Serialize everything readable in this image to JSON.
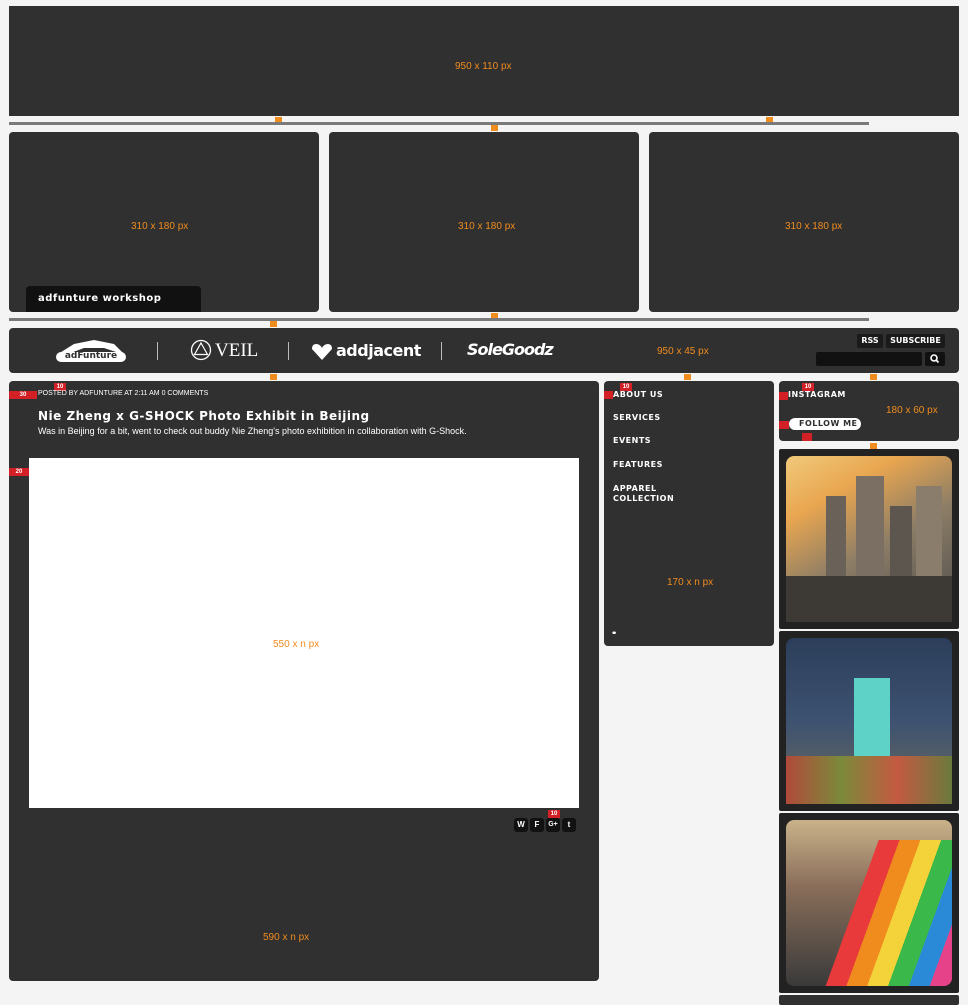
{
  "banner": {
    "dims": "950 x 110 px"
  },
  "slides": [
    {
      "dims": "310 x 180 px"
    },
    {
      "dims": "310 x 180 px"
    },
    {
      "dims": "310 x 180 px"
    }
  ],
  "slide_caption": "adfunture workshop",
  "nav": {
    "brands": [
      "adFunture",
      "VEIL",
      "addjacent",
      "SoleGoodz"
    ],
    "dims": "950 x 45 px",
    "rss_label": "RSS",
    "subscribe_label": "SUBSCRIBE",
    "search_value": ""
  },
  "post": {
    "meta": "POSTED BY ADFUNTURE AT 2:11 AM 0 comments",
    "title": "Nie Zheng x G-SHOCK Photo Exhibit in Beijing",
    "excerpt": "Was in Beijing for a bit, went to check out buddy Nie Zheng's photo exhibition in collaboration with G-Shock.",
    "image_dims": "550 x n px",
    "box_dims": "590  x n px",
    "share_icons": [
      "W",
      "F",
      "G+",
      "t"
    ]
  },
  "spacing_tags": {
    "t30": "30",
    "t10a": "10",
    "t20": "20",
    "t10b": "10",
    "t10c": "10",
    "t10d": "10",
    "t8a": "8",
    "t8b": "8"
  },
  "sidebar": {
    "items": [
      "ABOUT US",
      "SERVICES",
      "EVENTS",
      "FEATURES",
      "APPAREL COLLECTION"
    ],
    "dims": "170 x n px",
    "dots": "••"
  },
  "instagram": {
    "label": "INSTAGRAM",
    "dims": "180 x 60 px",
    "follow_label": "FOLLOW ME"
  },
  "photos": [
    "city-skyline-photo",
    "teal-door-photo",
    "rainbow-slide-photo"
  ],
  "colors": {
    "accent": "#f08c1e",
    "panel": "#303030",
    "tag": "#d32027",
    "background": "#f4f4f4"
  }
}
